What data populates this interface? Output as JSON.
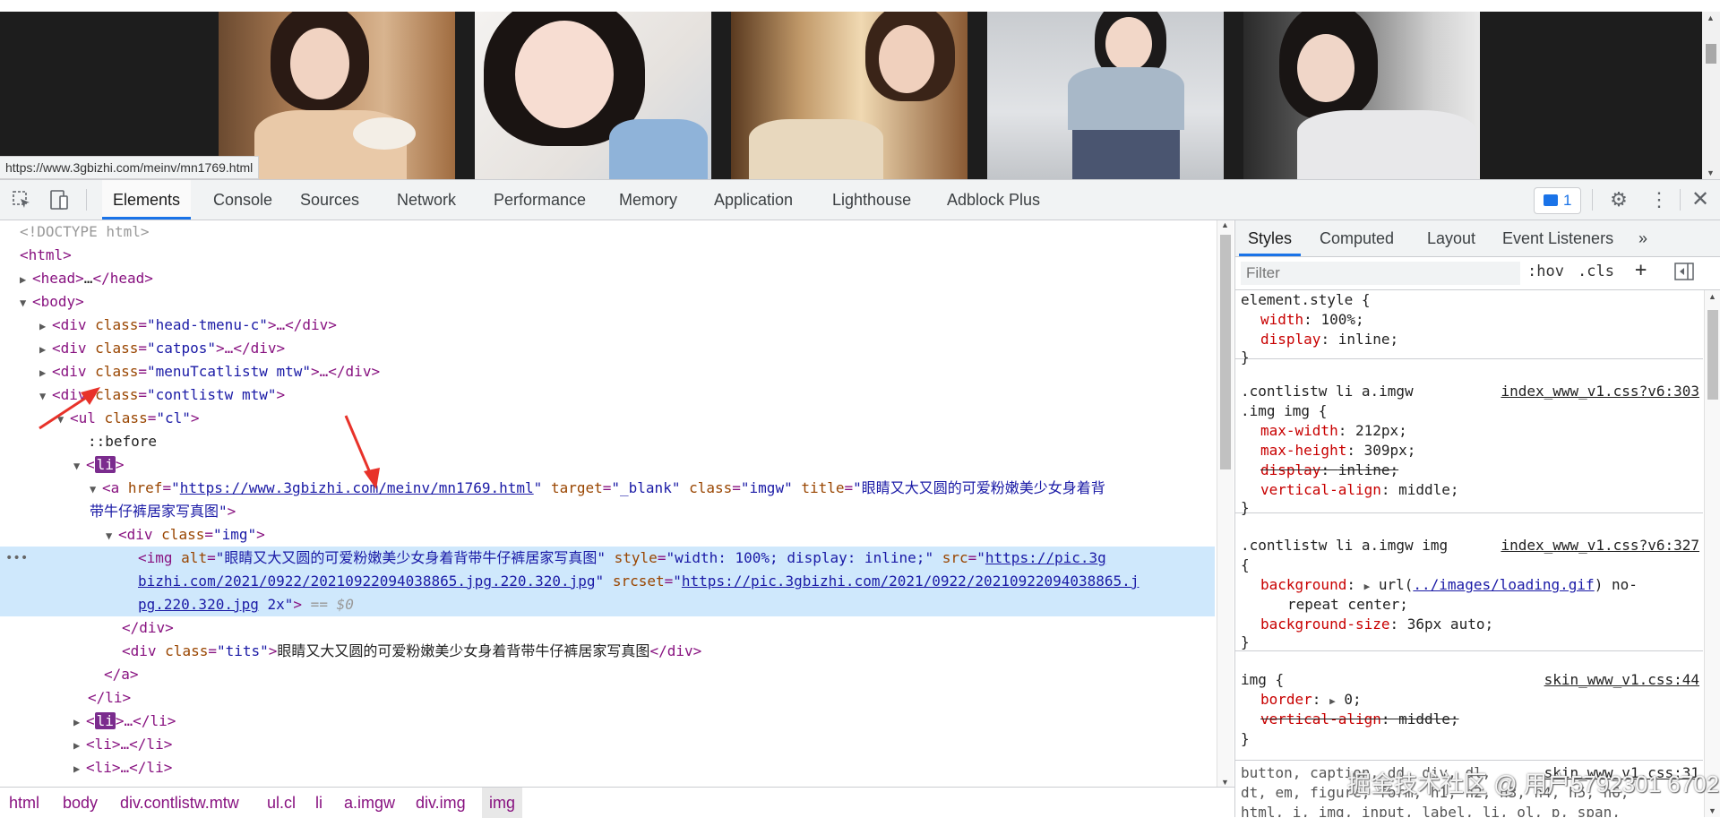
{
  "page": {
    "status_url": "https://www.3gbizhi.com/meinv/mn1769.html",
    "thumbnails": [
      "photo-1",
      "photo-2",
      "photo-3",
      "photo-4",
      "photo-5"
    ]
  },
  "toolbar": {
    "inspect_icon": "cursor-select-icon",
    "device_icon": "device-toggle-icon",
    "tabs": [
      "Elements",
      "Console",
      "Sources",
      "Network",
      "Performance",
      "Memory",
      "Application",
      "Lighthouse",
      "Adblock Plus"
    ],
    "issues_count": "1",
    "settings_icon": "gear-icon",
    "more_icon": "kebab-icon",
    "close_icon": "close-icon"
  },
  "dom": {
    "l1": "<!DOCTYPE html>",
    "l2_tag": "<html>",
    "l3_tag": "<head>",
    "l3_ell": "…",
    "l3_end": "</head>",
    "l4_tag": "<body>",
    "l5_open": "<div ",
    "l5_an": "class",
    "l5_av": "\"head-tmenu-c\"",
    "l5_end": ">…</div>",
    "l6_open": "<div ",
    "l6_an": "class",
    "l6_av": "\"catpos\"",
    "l6_end": ">…</div>",
    "l7_open": "<div ",
    "l7_an": "class",
    "l7_av": "\"menuTcatlistw mtw\"",
    "l7_end": ">…</div>",
    "l8_open": "<div ",
    "l8_an": "class",
    "l8_av": "\"contlistw mtw\"",
    "l8_end": ">",
    "l9_open": "<ul ",
    "l9_an": "class",
    "l9_av": "\"cl\"",
    "l9_end": ">",
    "l10": "::before",
    "l11_open": "<",
    "l11_name": "li",
    "l11_end": ">",
    "l12_open": "<a ",
    "l12_an1": "href",
    "l12_av1": "https://www.3gbizhi.com/meinv/mn1769.html",
    "l12_an2": "target",
    "l12_av2": "\"_blank\"",
    "l12_an3": "class",
    "l12_av3": "\"imgw\"",
    "l12_an4": "title",
    "l12_av4a": "\"眼睛又大又圆的可爱粉嫩美少女身着背",
    "l12_av4b": "带牛仔裤居家写真图\"",
    "l12_end": ">",
    "l14_open": "<div ",
    "l14_an": "class",
    "l14_av": "\"img\"",
    "l14_end": ">",
    "l15_open": "<img ",
    "l15_an1": "alt",
    "l15_av1": "\"眼睛又大又圆的可爱粉嫩美少女身着背带牛仔裤居家写真图\"",
    "l15_an2": "style",
    "l15_av2": "\"width: 100%; display: inline;\"",
    "l15_an3": "src",
    "l15_av3a": "https://pic.3g",
    "l15_av3b": "bizhi.com/2021/0922/20210922094038865.jpg.220.320.jpg",
    "l15_an4": "srcset",
    "l15_av4a": "https://pic.3gbizhi.com/2021/0922/20210922094038865.j",
    "l15_av4b": "pg.220.320.jpg",
    "l15_av4c": " 2x",
    "l15_end": ">",
    "l15_eq": " == $0",
    "l18": "</div>",
    "l19_open": "<div ",
    "l19_an": "class",
    "l19_av": "\"tits\"",
    "l19_text": "眼睛又大又圆的可爱粉嫩美少女身着背带牛仔裤居家写真图",
    "l19_end": "</div>",
    "l20": "</a>",
    "l21": "</li>",
    "l22_name": "li",
    "l22_end": "…</li>",
    "l23": "<li>…</li>",
    "l24": "<li>…</li>",
    "dots": "•••"
  },
  "breadcrumb": [
    "html",
    "body",
    "div.contlistw.mtw",
    "ul.cl",
    "li",
    "a.imgw",
    "div.img",
    "img"
  ],
  "styles": {
    "tabs": [
      "Styles",
      "Computed",
      "Layout",
      "Event Listeners"
    ],
    "more_tabs": "»",
    "filter_placeholder": "Filter",
    "hov": ":hov",
    "cls": ".cls",
    "plus": "+",
    "r1_sel": "element.style {",
    "r1_p1n": "width",
    "r1_p1v": "100%;",
    "r1_p2n": "display",
    "r1_p2v": "inline;",
    "close": "}",
    "r2_sel1": ".contlistw li a.imgw",
    "r2_src": "index_www_v1.css?v6:303",
    "r2_sel2": ".img img {",
    "r2_p1n": "max-width",
    "r2_p1v": "212px;",
    "r2_p2n": "max-height",
    "r2_p2v": "309px;",
    "r2_p3n": "display",
    "r2_p3v": "inline;",
    "r2_p4n": "vertical-align",
    "r2_p4v": "middle;",
    "r3_sel1": ".contlistw li a.imgw img",
    "r3_src": "index_www_v1.css?v6:327",
    "r3_open": "{",
    "r3_p1n": "background",
    "r3_p1v1": "url(",
    "r3_p1link": "../images/loading.gif",
    "r3_p1v2": ") no-",
    "r3_p1v3": "repeat center;",
    "r3_p2n": "background-size",
    "r3_p2v": "36px auto;",
    "r4_sel": "img {",
    "r4_src": "skin_www_v1.css:44",
    "r4_p1n": "border",
    "r4_p1v": "0;",
    "r4_p2n": "vertical-align",
    "r4_p2v": "middle;",
    "r5_sel1": "button, caption, dd, div, dl,",
    "r5_src": "skin_www_v1.css:31",
    "r5_sel2": "dt, em, figure, form, h1, h2, h3, h4, h5, h6,",
    "r5_sel3": "html, i, img, input, label, li, ol, p, span,"
  },
  "watermark": "掘金技术社区 @ 用户5792301 6702"
}
